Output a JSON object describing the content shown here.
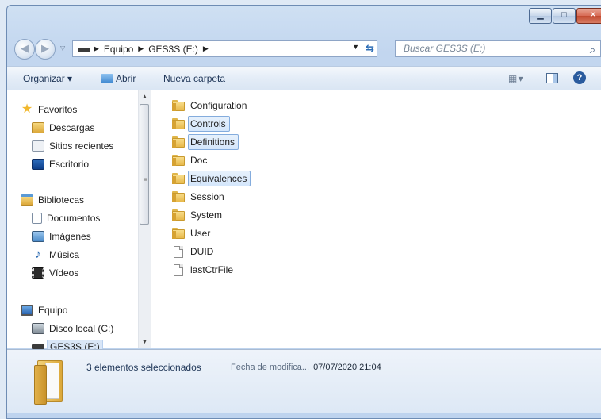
{
  "window": {
    "min_glyph": "▁",
    "max_glyph": "□",
    "close_glyph": "✕"
  },
  "address": {
    "crumbs": [
      "Equipo",
      "GES3S (E:)"
    ],
    "search_placeholder": "Buscar GES3S (E:)"
  },
  "toolbar": {
    "organize": "Organizar ▾",
    "open": "Abrir",
    "new_folder": "Nueva carpeta"
  },
  "nav": {
    "favorites": "Favoritos",
    "downloads": "Descargas",
    "recent": "Sitios recientes",
    "desktop": "Escritorio",
    "libraries": "Bibliotecas",
    "documents": "Documentos",
    "images": "Imágenes",
    "music": "Música",
    "videos": "Vídeos",
    "computer": "Equipo",
    "local_disk": "Disco local (C:)",
    "ges3s": "GES3S (E:)"
  },
  "files": [
    {
      "name": "Configuration",
      "type": "folder",
      "selected": false
    },
    {
      "name": "Controls",
      "type": "folder",
      "selected": true
    },
    {
      "name": "Definitions",
      "type": "folder",
      "selected": true
    },
    {
      "name": "Doc",
      "type": "folder",
      "selected": false
    },
    {
      "name": "Equivalences",
      "type": "folder",
      "selected": true
    },
    {
      "name": "Session",
      "type": "folder",
      "selected": false
    },
    {
      "name": "System",
      "type": "folder",
      "selected": false
    },
    {
      "name": "User",
      "type": "folder",
      "selected": false
    },
    {
      "name": "DUID",
      "type": "file",
      "selected": false
    },
    {
      "name": "lastCtrFile",
      "type": "file",
      "selected": false
    }
  ],
  "status": {
    "selection": "3 elementos seleccionados",
    "date_label": "Fecha de modifica...",
    "date_value": "07/07/2020 21:04"
  }
}
